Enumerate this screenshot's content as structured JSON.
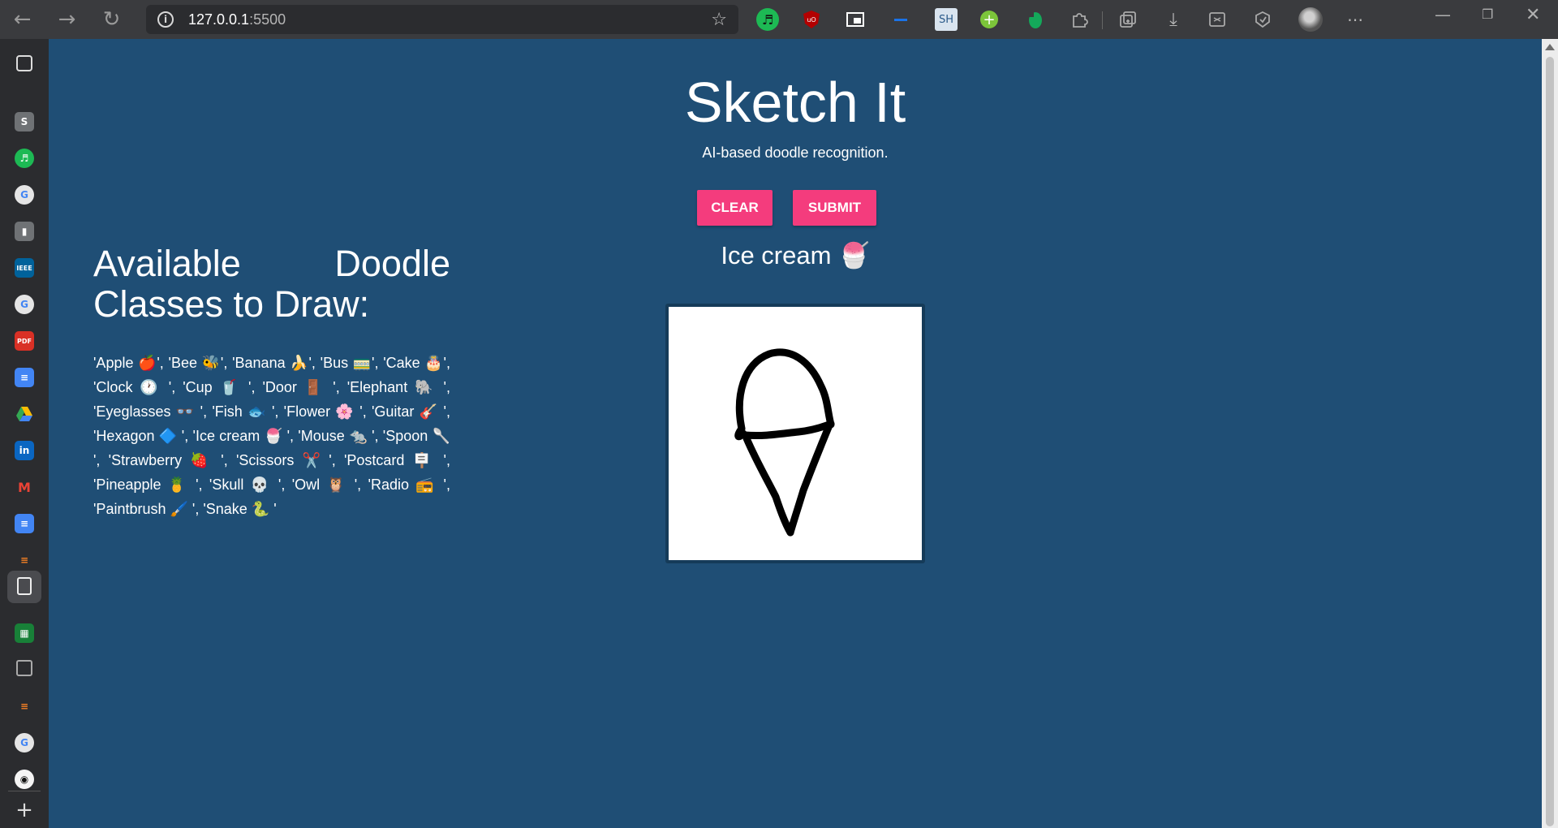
{
  "browser": {
    "url_host": "127.0.0.1",
    "url_port": ":5500",
    "extensions": [
      "spotify-icon",
      "ublock-icon",
      "picture-in-picture-icon",
      "extension-icon",
      "sh-icon",
      "add-icon",
      "evernote-icon",
      "puzzle-icon",
      "collections-icon",
      "download-icon",
      "screenshot-icon",
      "performance-icon",
      "profile-avatar",
      "more-icon"
    ],
    "ext_sh_label": "SH"
  },
  "sidebar": {
    "items": [
      "tab-actions-icon",
      "s-icon",
      "spotify-icon",
      "google-icon",
      "doc-icon",
      "ieee-icon",
      "google-icon",
      "pdf-icon",
      "docs-icon",
      "drive-icon",
      "linkedin-icon",
      "gmail-icon",
      "docs-icon",
      "stack-icon",
      "page-icon",
      "sheets-icon",
      "calendar-icon",
      "stack-icon",
      "google-icon",
      "github-icon",
      "add-icon"
    ]
  },
  "app": {
    "title": "Sketch It",
    "subtitle": "AI-based doodle recognition.",
    "clear_label": "CLEAR",
    "submit_label": "SUBMIT",
    "prediction": "Ice cream 🍧",
    "classes_heading": "Available Doodle Classes to Draw:",
    "classes_text": "'Apple 🍎', 'Bee 🐝', 'Banana 🍌', 'Bus 🚃', 'Cake 🎂', 'Clock 🕐 ', 'Cup 🥤 ', 'Door 🚪 ', 'Elephant 🐘 ', 'Eyeglasses 👓 ', 'Fish 🐟 ', 'Flower 🌸 ', 'Guitar 🎸 ', 'Hexagon 🔷 ', 'Ice cream 🍧 ', 'Mouse 🐀 ', 'Spoon 🥄 ', 'Strawberry 🍓 ', 'Scissors ✂️ ', 'Postcard 🪧 ', 'Pineapple 🍍 ', 'Skull 💀 ', 'Owl 🦉 ', 'Radio 📻 ', 'Paintbrush 🖌️ ', 'Snake 🐍 '"
  },
  "colors": {
    "page_bg": "#1f4e75",
    "button": "#f43c7d",
    "canvas_bg": "#ffffff",
    "stroke": "#000000"
  }
}
